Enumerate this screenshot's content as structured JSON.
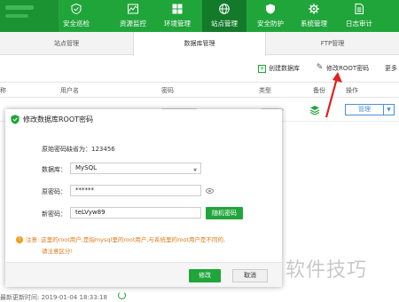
{
  "nav": {
    "items": [
      {
        "label": "安全巡检",
        "icon": "shield-check-icon"
      },
      {
        "label": "资源监控",
        "icon": "monitor-icon"
      },
      {
        "label": "环境管理",
        "icon": "grid-icon"
      },
      {
        "label": "站点管理",
        "icon": "globe-icon"
      },
      {
        "label": "安全防护",
        "icon": "shield-icon"
      },
      {
        "label": "系统管理",
        "icon": "gear-icon"
      },
      {
        "label": "日志审计",
        "icon": "document-icon"
      }
    ],
    "active": "站点管理"
  },
  "tabs": {
    "items": [
      "站点管理",
      "数据库管理",
      "FTP管理"
    ],
    "active": "数据库管理"
  },
  "toolbar": {
    "create_db": "创建数据库",
    "modify_root": "修改ROOT密码",
    "more": "更多"
  },
  "table": {
    "headers": [
      "称",
      "用户名",
      "密码",
      "类型",
      "备份",
      "操作"
    ],
    "row_action": "管理"
  },
  "modal": {
    "title": "修改数据库ROOT密码",
    "default_pw_text": "原始密码缺省为：123456",
    "db_label": "数据库：",
    "db_value": "MySQL",
    "old_pw_label": "原密码：",
    "old_pw_value": "******",
    "new_pw_label": "新密码：",
    "new_pw_value": "teLVyw89",
    "random_btn": "随机密码",
    "notice_line1": "注意: 这里的root用户,是指mysql里的root用户,与系统里的root用户是不同的,",
    "notice_line2": "请注意区分!",
    "confirm_btn": "修改",
    "cancel_btn": "取消"
  },
  "footer": {
    "update_time": "最新更新时间: 2019-01-04 18:33:18"
  },
  "watermark": "软件技巧",
  "colors": {
    "brand_green": "#20a53a",
    "link_blue": "#4a90d9",
    "warning_orange": "#e07b1a",
    "arrow_red": "#e02020"
  }
}
